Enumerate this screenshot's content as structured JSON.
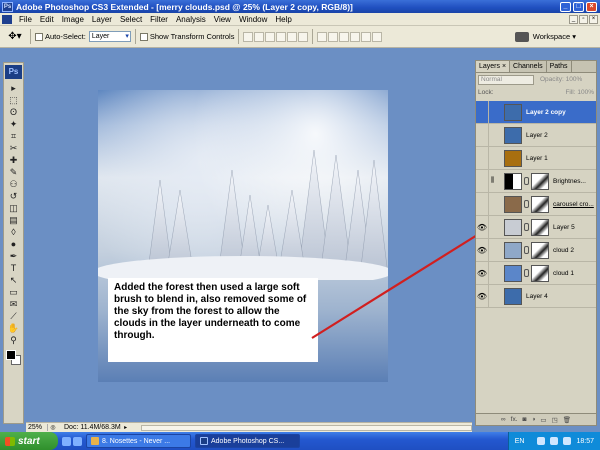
{
  "window": {
    "title": "Adobe Photoshop CS3 Extended - [merry clouds.psd @ 25% (Layer 2 copy, RGB/8)]",
    "app_icon_text": "Ps"
  },
  "menu": [
    "File",
    "Edit",
    "Image",
    "Layer",
    "Select",
    "Filter",
    "Analysis",
    "View",
    "Window",
    "Help"
  ],
  "options": {
    "auto_select_label": "Auto-Select:",
    "auto_select_value": "Layer",
    "show_transform_label": "Show Transform Controls",
    "workspace_label": "Workspace ▾"
  },
  "toolbox": {
    "logo": "Ps",
    "tools": [
      "move-tool",
      "marquee-tool",
      "lasso-tool",
      "magic-wand-tool",
      "crop-tool",
      "slice-tool",
      "healing-brush-tool",
      "brush-tool",
      "clone-stamp-tool",
      "history-brush-tool",
      "eraser-tool",
      "gradient-tool",
      "blur-tool",
      "dodge-tool",
      "pen-tool",
      "type-tool",
      "path-selection-tool",
      "shape-tool",
      "notes-tool",
      "eyedropper-tool",
      "hand-tool",
      "zoom-tool"
    ],
    "tool_glyphs": [
      "▸",
      "⬚",
      "ʘ",
      "✦",
      "⌗",
      "✂",
      "✚",
      "✎",
      "⚇",
      "↺",
      "◫",
      "▤",
      "◊",
      "●",
      "✒",
      "T",
      "↖",
      "▭",
      "✉",
      "⟋",
      "✋",
      "⚲"
    ],
    "foreground_color": "#000000",
    "background_color": "#ffffff"
  },
  "canvas": {
    "annotation": "Added the forest then used a large soft brush to blend in, also removed some of the sky from the forest to allow the clouds in the layer underneath to come through.",
    "arrow_color": "#d11f1f"
  },
  "status": {
    "zoom": "25%",
    "doc_size": "Doc: 11.4M/68.3M"
  },
  "layers_panel": {
    "tabs": [
      "Layers ×",
      "Channels",
      "Paths"
    ],
    "blend_mode": "Normal",
    "opacity_label": "Opacity: 100%",
    "lock_label": "Lock:",
    "fill_label": "Fill: 100%",
    "layers": [
      {
        "name": "Layer 2 copy",
        "thumb_color": "#3d6cab",
        "visible": false,
        "selected": true,
        "has_mask": false
      },
      {
        "name": "Layer 2",
        "thumb_color": "#3d6cab",
        "visible": false,
        "selected": false,
        "has_mask": false
      },
      {
        "name": "Layer 1",
        "thumb_color": "#a86f10",
        "visible": false,
        "selected": false,
        "has_mask": false
      },
      {
        "name": "Brightnes...",
        "thumb_color": "#ffffff",
        "visible": false,
        "selected": false,
        "has_mask": true,
        "adjustment": true
      },
      {
        "name": "carousel cro...",
        "thumb_color": "#8a6a4a",
        "visible": false,
        "selected": false,
        "has_mask": true,
        "underlined": true
      },
      {
        "name": "Layer 5",
        "thumb_color": "#c8ccd3",
        "visible": true,
        "selected": false,
        "has_mask": true
      },
      {
        "name": "cloud 2",
        "thumb_color": "#8fa8c8",
        "visible": true,
        "selected": false,
        "has_mask": true
      },
      {
        "name": "cloud 1",
        "thumb_color": "#5b86c9",
        "visible": true,
        "selected": false,
        "has_mask": true
      },
      {
        "name": "Layer 4",
        "thumb_color": "#3d6cab",
        "visible": true,
        "selected": false,
        "has_mask": false
      }
    ],
    "bottom_icons": [
      "∞",
      "fx.",
      "◙",
      "◑",
      "▭",
      "◳",
      "🗑"
    ]
  },
  "taskbar": {
    "start_label": "start",
    "tasks": [
      {
        "label": "8. Nosettes - Never ...",
        "active": false
      },
      {
        "label": "Adobe Photoshop CS...",
        "active": true
      }
    ],
    "lang": "EN",
    "clock": "18:57"
  }
}
